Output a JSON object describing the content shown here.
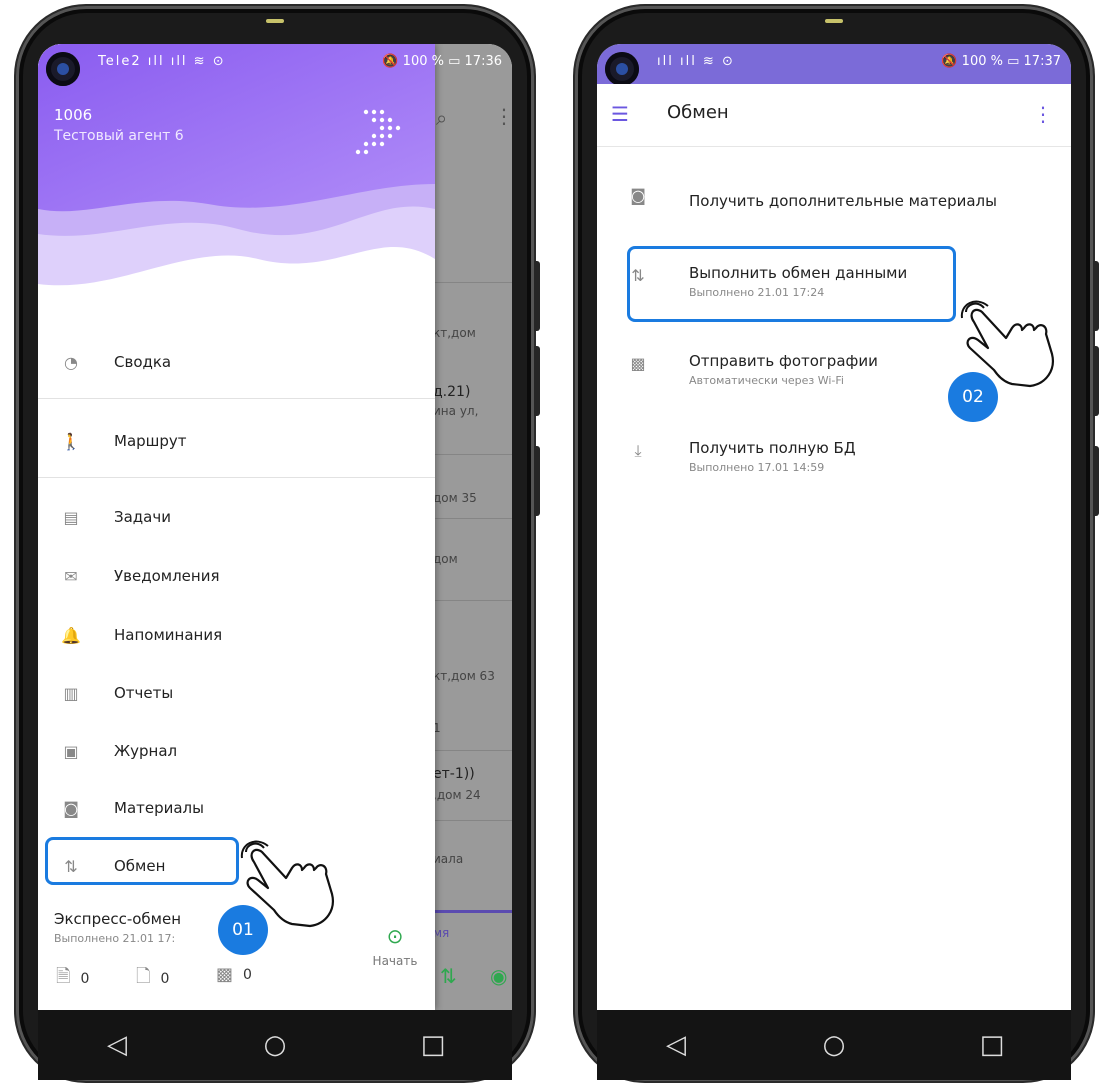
{
  "left": {
    "status": {
      "left_icons": "Tele2 ⁠ıll ıll ≋ ⊙",
      "right": "🔕 100 % ▭ 17:36"
    },
    "drawer": {
      "id": "1006",
      "agent": "Тестовый агент 6"
    },
    "menu": [
      {
        "label": "Сводка",
        "icon": "gauge-icon",
        "glyph": "◔"
      },
      {
        "label": "Маршрут",
        "icon": "walk-icon",
        "glyph": "🚶"
      },
      {
        "label": "Задачи",
        "icon": "clipboard-icon",
        "glyph": "▤"
      },
      {
        "label": "Уведомления",
        "icon": "mail-icon",
        "glyph": "✉"
      },
      {
        "label": "Напоминания",
        "icon": "bell-icon",
        "glyph": "🔔"
      },
      {
        "label": "Отчеты",
        "icon": "bar-chart-icon",
        "glyph": "▥"
      },
      {
        "label": "Журнал",
        "icon": "journal-icon",
        "glyph": "▣"
      },
      {
        "label": "Материалы",
        "icon": "materials-icon",
        "glyph": "◙"
      },
      {
        "label": "Обмен",
        "icon": "exchange-icon",
        "glyph": "⇅"
      }
    ],
    "express": {
      "title": "Экспресс-обмен",
      "subtitle": "Выполнено 21.01 17:",
      "counters": [
        "0",
        "0",
        "0"
      ],
      "start_label": "Начать"
    },
    "badge": "01",
    "background_rows": [
      "кт,дом",
      "д.21)",
      "ина ул,",
      "дом 35",
      "дом",
      "кт,дом 63",
      "1",
      "ет-1))",
      ",дом 24",
      "иала",
      "мя"
    ]
  },
  "right": {
    "status": {
      "left_icons": "ıll ıll ≋ ⊙",
      "right": "🔕 100 % ▭ 17:37"
    },
    "appbar": {
      "title": "Обмен"
    },
    "items": [
      {
        "label": "Получить дополнительные материалы",
        "sub": "",
        "icon": "materials-icon",
        "glyph": "◙"
      },
      {
        "label": "Выполнить обмен данными",
        "sub": "Выполнено 21.01 17:24",
        "icon": "exchange-icon",
        "glyph": "⇅"
      },
      {
        "label": "Отправить фотографии",
        "sub": "Автоматически через Wi-Fi",
        "icon": "image-icon",
        "glyph": "▩"
      },
      {
        "label": "Получить полную БД",
        "sub": "Выполнено 17.01 14:59",
        "icon": "download-icon",
        "glyph": "⤓"
      }
    ],
    "badge": "02"
  },
  "nav": {
    "back": "◁",
    "home": "○",
    "recent": "□"
  },
  "colors": {
    "accent": "#6b57e0",
    "highlight": "#1a7be0",
    "start": "#2fa84f"
  }
}
